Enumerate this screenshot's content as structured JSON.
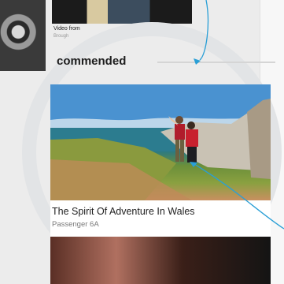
{
  "top": {
    "video_caption": "Video from",
    "video_source": "Brough"
  },
  "recommended": {
    "title": "commended"
  },
  "card": {
    "title": "The Spirit Of Adventure In Wales",
    "source": "Passenger 6A"
  },
  "colors": {
    "ring": "#e2e4e6",
    "annotation_line": "#2a9fd6",
    "background": "#ececec"
  }
}
